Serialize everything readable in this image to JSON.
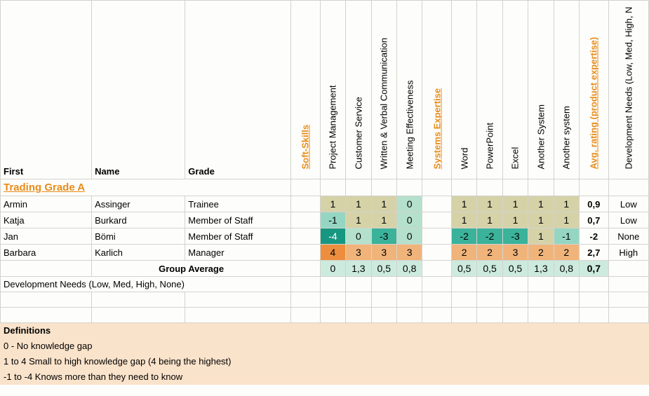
{
  "headers": {
    "first": "First",
    "name": "Name",
    "grade": "Grade",
    "soft_skills": "Soft-Skills",
    "systems_expertise": "Systems Expertise",
    "avg_rating": "Avg. rating (product expertise)",
    "dev_needs_long": "Development Needs (Low, Med, High, N"
  },
  "soft_skill_cols": [
    "Project Management",
    "Customer Service",
    "Written & Verbal Communication",
    "Meeting Effectiveness"
  ],
  "system_cols": [
    "Word",
    "PowerPoint",
    "Excel",
    "Another System",
    "Another system"
  ],
  "group_title": "Trading Grade A",
  "rows": [
    {
      "first": "Armin",
      "name": "Assinger",
      "grade": "Trainee",
      "soft": [
        "1",
        "1",
        "1",
        "0"
      ],
      "sys": [
        "1",
        "1",
        "1",
        "1",
        "1"
      ],
      "avg": "0,9",
      "need": "Low"
    },
    {
      "first": "Katja",
      "name": "Burkard",
      "grade": "Member of Staff",
      "soft": [
        "-1",
        "1",
        "1",
        "0"
      ],
      "sys": [
        "1",
        "1",
        "1",
        "1",
        "1"
      ],
      "avg": "0,7",
      "need": "Low"
    },
    {
      "first": "Jan",
      "name": "Bömi",
      "grade": "Member of Staff",
      "soft": [
        "-4",
        "0",
        "-3",
        "0"
      ],
      "sys": [
        "-2",
        "-2",
        "-3",
        "1",
        "-1"
      ],
      "avg": "-2",
      "need": "None"
    },
    {
      "first": "Barbara",
      "name": "Karlich",
      "grade": "Manager",
      "soft": [
        "4",
        "3",
        "3",
        "3"
      ],
      "sys": [
        "2",
        "2",
        "3",
        "2",
        "2"
      ],
      "avg": "2,7",
      "need": "High"
    }
  ],
  "group_average_label": "Group Average",
  "group_average": {
    "soft": [
      "0",
      "1,3",
      "0,5",
      "0,8"
    ],
    "sys": [
      "0,5",
      "0,5",
      "0,5",
      "1,3",
      "0,8"
    ],
    "avg": "0,7"
  },
  "dev_needs_row": "Development Needs (Low, Med, High, None)",
  "definitions": {
    "title": "Definitions",
    "lines": [
      "0 - No knowledge gap",
      "1 to 4 Small to high knowledge gap (4 being the highest)",
      "-1 to -4 Knows more than they need to know"
    ]
  },
  "chart_data": {
    "type": "table",
    "title": "Trading Grade A — skill gap matrix",
    "row_labels": [
      "Armin Assinger",
      "Katja Burkard",
      "Jan Bömi",
      "Barbara Karlich",
      "Group Average"
    ],
    "column_groups": {
      "Soft-Skills": [
        "Project Management",
        "Customer Service",
        "Written & Verbal Communication",
        "Meeting Effectiveness"
      ],
      "Systems Expertise": [
        "Word",
        "PowerPoint",
        "Excel",
        "Another System",
        "Another system"
      ],
      "Summary": [
        "Avg. rating (product expertise)",
        "Development Needs"
      ]
    },
    "values": [
      [
        1,
        1,
        1,
        0,
        1,
        1,
        1,
        1,
        1,
        0.9,
        "Low"
      ],
      [
        -1,
        1,
        1,
        0,
        1,
        1,
        1,
        1,
        1,
        0.7,
        "Low"
      ],
      [
        -4,
        0,
        -3,
        0,
        -2,
        -2,
        -3,
        1,
        -1,
        -2,
        "None"
      ],
      [
        4,
        3,
        3,
        3,
        2,
        2,
        3,
        2,
        2,
        2.7,
        "High"
      ],
      [
        0,
        1.3,
        0.5,
        0.8,
        0.5,
        0.5,
        0.5,
        1.3,
        0.8,
        0.7,
        null
      ]
    ],
    "legend": {
      "0": "No knowledge gap",
      "1..4": "Small to high knowledge gap (4 highest)",
      "-1..-4": "Knows more than they need to know"
    }
  }
}
